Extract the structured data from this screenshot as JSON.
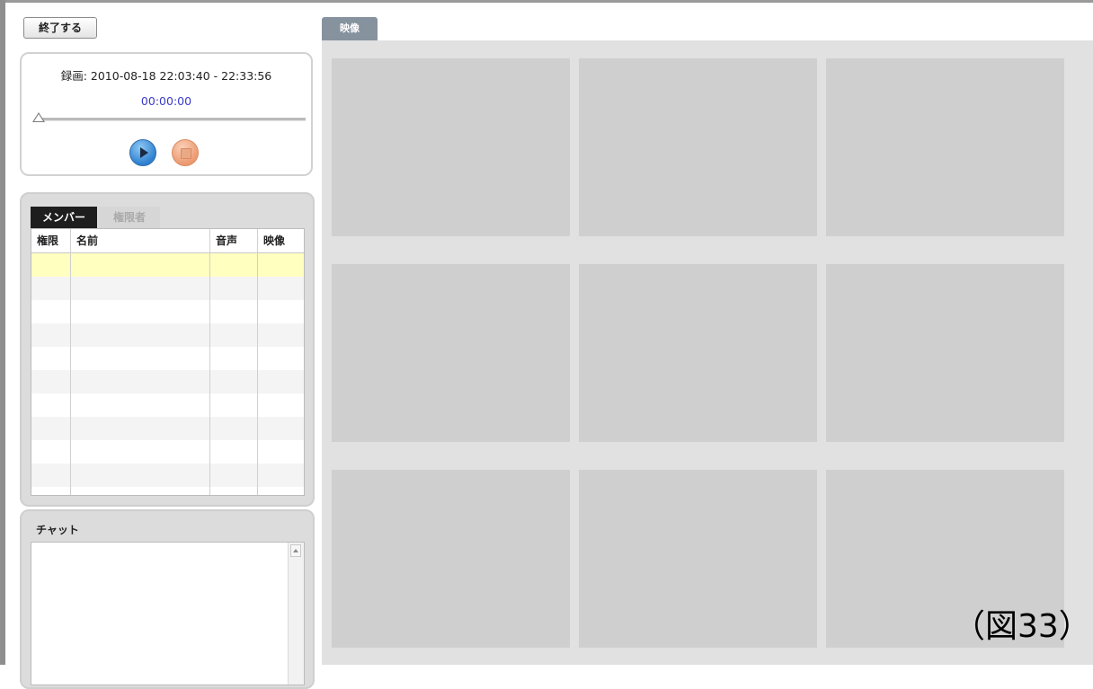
{
  "toolbar": {
    "end_label": "終了する"
  },
  "player": {
    "recording_label": "録画: 2010-08-18 22:03:40 - 22:33:56",
    "current_time": "00:00:00",
    "progress": 0
  },
  "members": {
    "tabs": [
      {
        "label": "メンバー",
        "active": true
      },
      {
        "label": "権限者",
        "active": false
      }
    ],
    "columns": [
      "権限",
      "名前",
      "音声",
      "映像"
    ],
    "rows": [
      [
        "",
        "",
        "",
        ""
      ],
      [
        "",
        "",
        "",
        ""
      ],
      [
        "",
        "",
        "",
        ""
      ],
      [
        "",
        "",
        "",
        ""
      ],
      [
        "",
        "",
        "",
        ""
      ],
      [
        "",
        "",
        "",
        ""
      ],
      [
        "",
        "",
        "",
        ""
      ],
      [
        "",
        "",
        "",
        ""
      ],
      [
        "",
        "",
        "",
        ""
      ],
      [
        "",
        "",
        "",
        ""
      ]
    ],
    "selected_row": 0
  },
  "chat": {
    "title": "チャット"
  },
  "video": {
    "tab_label": "映像",
    "slot_count": 9
  },
  "figure_label": "（図33）",
  "colors": {
    "selected_row": "#ffffc0",
    "stripe": "#f4f4f4",
    "video_bg": "#e1e1e1",
    "slot": "#cfcfcf",
    "tab": "#86939e"
  }
}
